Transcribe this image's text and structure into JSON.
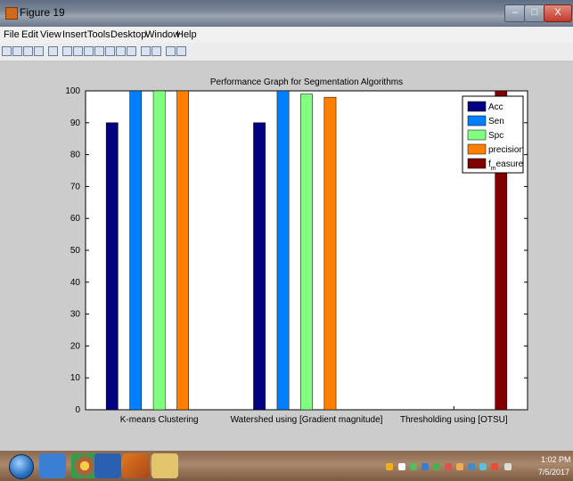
{
  "window": {
    "title": "Figure 19",
    "minimize": "–",
    "maximize": "□",
    "close": "X"
  },
  "menu": [
    "File",
    "Edit",
    "View",
    "Insert",
    "Tools",
    "Desktop",
    "Window",
    "Help"
  ],
  "toolbar_icons": [
    "new-figure-icon",
    "open-icon",
    "save-icon",
    "print-icon",
    "pointer-icon",
    "zoom-in-icon",
    "zoom-out-icon",
    "pan-icon",
    "rotate-icon",
    "data-cursor-icon",
    "brush-icon",
    "link-icon",
    "colorbar-icon",
    "legend-icon",
    "hide-plot-tools-icon",
    "show-plot-tools-icon"
  ],
  "chart_data": {
    "type": "bar",
    "title": "Performance Graph for Segmentation Algorithms",
    "xlabel": "",
    "ylabel": "",
    "categories": [
      "K-means Clustering",
      "Watershed using [Gradient magnitude]",
      "Thresholding using [OTSU]"
    ],
    "ylim": [
      0,
      100
    ],
    "yticks": [
      0,
      10,
      20,
      30,
      40,
      50,
      60,
      70,
      80,
      90,
      100
    ],
    "legend_position": "top-right",
    "series": [
      {
        "name": "Acc",
        "color": "#000080",
        "values": [
          90,
          90,
          null
        ]
      },
      {
        "name": "Sen",
        "color": "#0080ff",
        "values": [
          100,
          100,
          null
        ]
      },
      {
        "name": "Spc",
        "color": "#80ff80",
        "values": [
          100,
          99,
          null
        ]
      },
      {
        "name": "precision",
        "color": "#ff8000",
        "values": [
          100,
          98,
          null
        ]
      },
      {
        "name": "f_measure",
        "legend_text": "f",
        "legend_sub": "m",
        "legend_tail": "easure",
        "color": "#800000",
        "values": [
          null,
          null,
          100
        ]
      }
    ]
  },
  "taskbar": {
    "apps": [
      "start-orb-icon",
      "internet-explorer-icon",
      "chrome-icon",
      "word-icon",
      "matlab-icon",
      "folder-icon"
    ],
    "clock_time": "1:02 PM",
    "clock_date": "7/5/2017"
  }
}
